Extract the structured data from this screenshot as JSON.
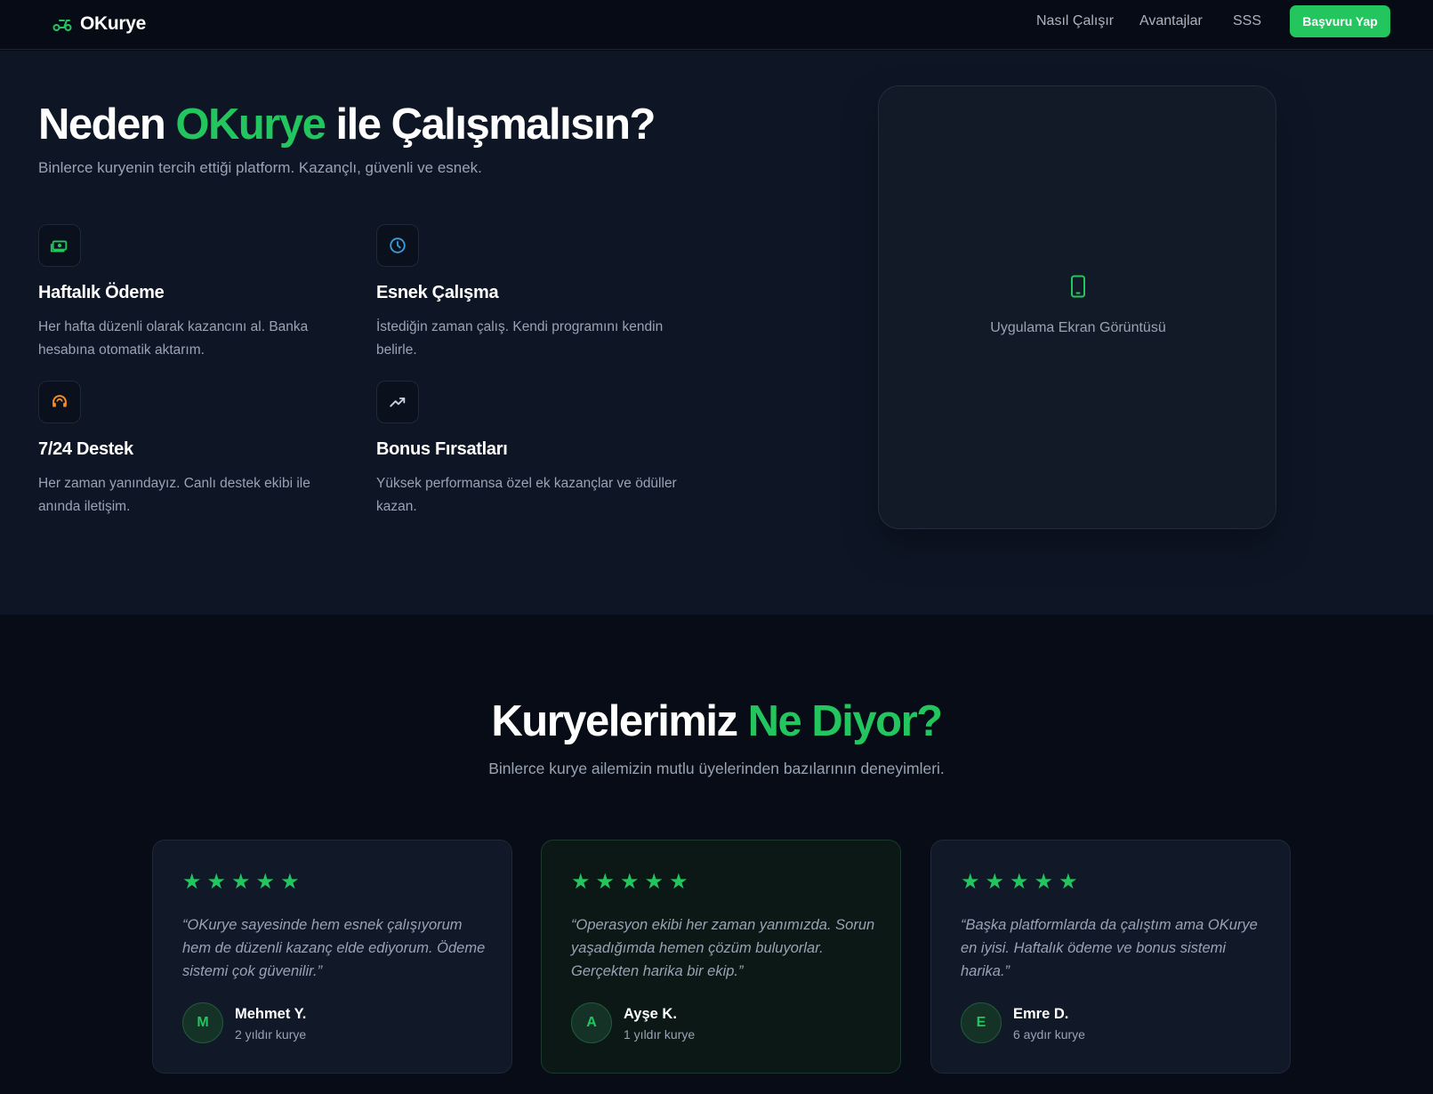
{
  "nav": {
    "brand": "OKurye",
    "links": [
      "Nasıl Çalışır",
      "Avantajlar",
      "SSS"
    ],
    "cta": "Başvuru Yap"
  },
  "hero": {
    "title_pre": "Neden ",
    "title_accent": "OKurye",
    "title_post": " ile Çalışmalısın?",
    "subtitle": "Binlerce kuryenin tercih ettiği platform. Kazançlı, güvenli ve esnek.",
    "features": [
      {
        "icon": "money-icon",
        "title": "Haftalık Ödeme",
        "desc": "Her hafta düzenli olarak kazancını al. Banka hesabına otomatik aktarım.",
        "color": "#22c55e"
      },
      {
        "icon": "clock-icon",
        "title": "Esnek Çalışma",
        "desc": "İstediğin zaman çalış. Kendi programını kendin belirle.",
        "color": "#3b9ddb"
      },
      {
        "icon": "headset-icon",
        "title": "7/24 Destek",
        "desc": "Her zaman yanındayız. Canlı destek ekibi ile anında iletişim.",
        "color": "#f28c28"
      },
      {
        "icon": "trending-up-icon",
        "title": "Bonus Fırsatları",
        "desc": "Yüksek performansa özel ek kazançlar ve ödüller kazan.",
        "color": "#c7d2e3"
      }
    ],
    "screenshot_caption": "Uygulama Ekran Görüntüsü"
  },
  "testimonials": {
    "title_pre": "Kuryelerimiz ",
    "title_accent": "Ne Diyor?",
    "subtitle": "Binlerce kurye ailemizin mutlu üyelerinden bazılarının deneyimleri.",
    "items": [
      {
        "stars": 5,
        "quote": "“OKurye sayesinde hem esnek çalışıyorum hem de düzenli kazanç elde ediyorum. Ödeme sistemi çok güvenilir.”",
        "initial": "M",
        "name": "Mehmet Y.",
        "tenure": "2 yıldır kurye"
      },
      {
        "stars": 5,
        "quote": "“Operasyon ekibi her zaman yanımızda. Sorun yaşadığımda hemen çözüm buluyorlar. Gerçekten harika bir ekip.”",
        "initial": "A",
        "name": "Ayşe K.",
        "tenure": "1 yıldır kurye"
      },
      {
        "stars": 5,
        "quote": "“Başka platformlarda da çalıştım ama OKurye en iyisi. Haftalık ödeme ve bonus sistemi harika.”",
        "initial": "E",
        "name": "Emre D.",
        "tenure": "6 aydır kurye"
      }
    ]
  },
  "colors": {
    "accent": "#22c55e",
    "background": "#070c16",
    "hero_bg": "#0e1626"
  }
}
